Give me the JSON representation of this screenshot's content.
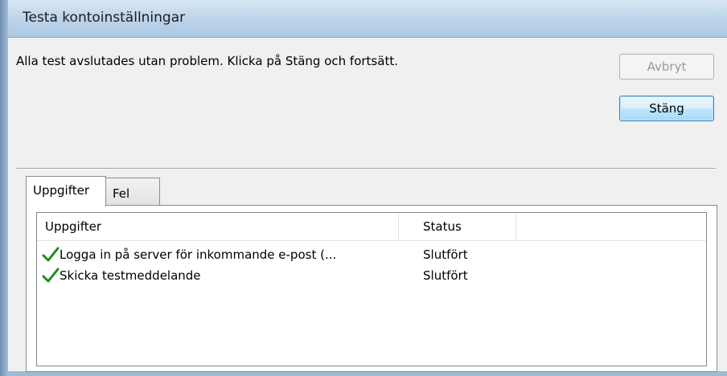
{
  "window": {
    "title": "Testa kontoinställningar"
  },
  "message": "Alla test avslutades utan problem. Klicka på Stäng och fortsätt.",
  "buttons": {
    "cancel_label": "Avbryt",
    "close_label": "Stäng"
  },
  "tabs": [
    {
      "label": "Uppgifter",
      "active": true
    },
    {
      "label": "Fel",
      "active": false
    }
  ],
  "table": {
    "columns": [
      "Uppgifter",
      "Status"
    ],
    "rows": [
      {
        "task": "Logga in på server för inkommande e-post (...",
        "status": "Slutfört",
        "icon": "check-icon"
      },
      {
        "task": "Skicka testmeddelande",
        "status": "Slutfört",
        "icon": "check-icon"
      }
    ]
  },
  "colors": {
    "check": "#1e8c1e",
    "frame": "#a9c3dd"
  }
}
